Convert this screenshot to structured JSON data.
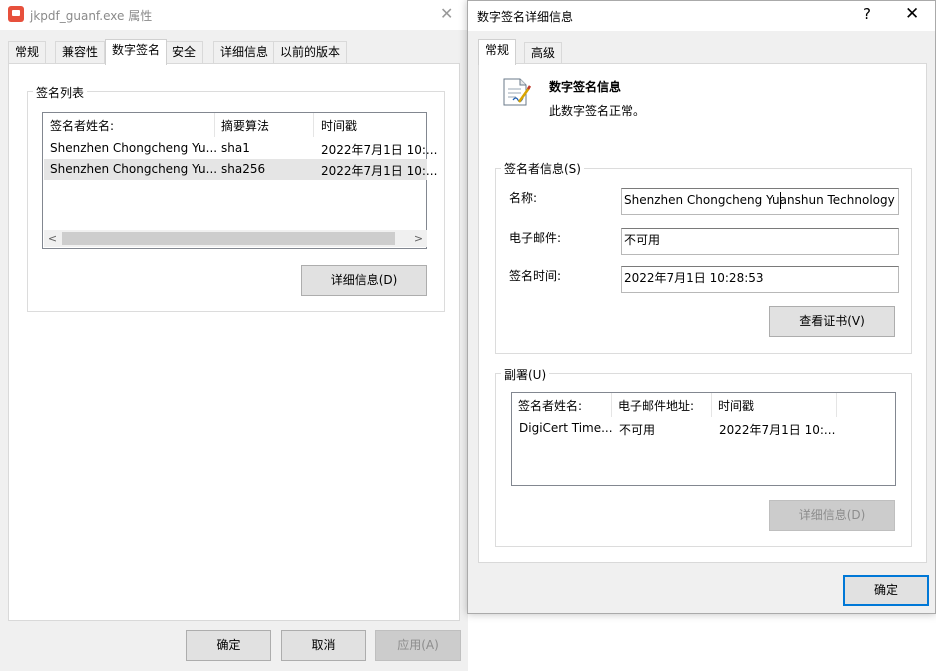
{
  "properties_window": {
    "title": "jkpdf_guanf.exe 属性",
    "tabs": [
      "常规",
      "兼容性",
      "数字签名",
      "安全",
      "详细信息",
      "以前的版本"
    ],
    "active_tab": 2,
    "signature_list": {
      "group_label": "签名列表",
      "columns": [
        "签名者姓名:",
        "摘要算法",
        "时间戳"
      ],
      "rows": [
        {
          "name": "Shenzhen Chongcheng Yu...",
          "algorithm": "sha1",
          "timestamp": "2022年7月1日 10:..."
        },
        {
          "name": "Shenzhen Chongcheng Yu...",
          "algorithm": "sha256",
          "timestamp": "2022年7月1日 10:..."
        }
      ],
      "selected_row": 1
    },
    "details_button": "详细信息(D)",
    "ok_button": "确定",
    "cancel_button": "取消",
    "apply_button": "应用(A)"
  },
  "details_window": {
    "title": "数字签名详细信息",
    "help_glyph": "?",
    "close_glyph": "✕",
    "tabs": [
      "常规",
      "高级"
    ],
    "active_tab": 0,
    "info_heading": "数字签名信息",
    "info_status": "此数字签名正常。",
    "signer_group": {
      "label": "签名者信息(S)",
      "name_label": "名称:",
      "name_value": "Shenzhen Chongcheng Yuanshun Technology Co",
      "email_label": "电子邮件:",
      "email_value": "不可用",
      "time_label": "签名时间:",
      "time_value": "2022年7月1日 10:28:53",
      "view_cert_button": "查看证书(V)"
    },
    "countersig_group": {
      "label": "副署(U)",
      "columns": [
        "签名者姓名:",
        "电子邮件地址:",
        "时间戳"
      ],
      "rows": [
        {
          "name": "DigiCert Time...",
          "email": "不可用",
          "timestamp": "2022年7月1日 10:..."
        }
      ],
      "details_button": "详细信息(D)"
    },
    "ok_button": "确定"
  },
  "colors": {
    "accent_focus": "#0078d7",
    "window_bg": "#f0f0f0",
    "selected_row_bg": "#e5e5e5"
  }
}
